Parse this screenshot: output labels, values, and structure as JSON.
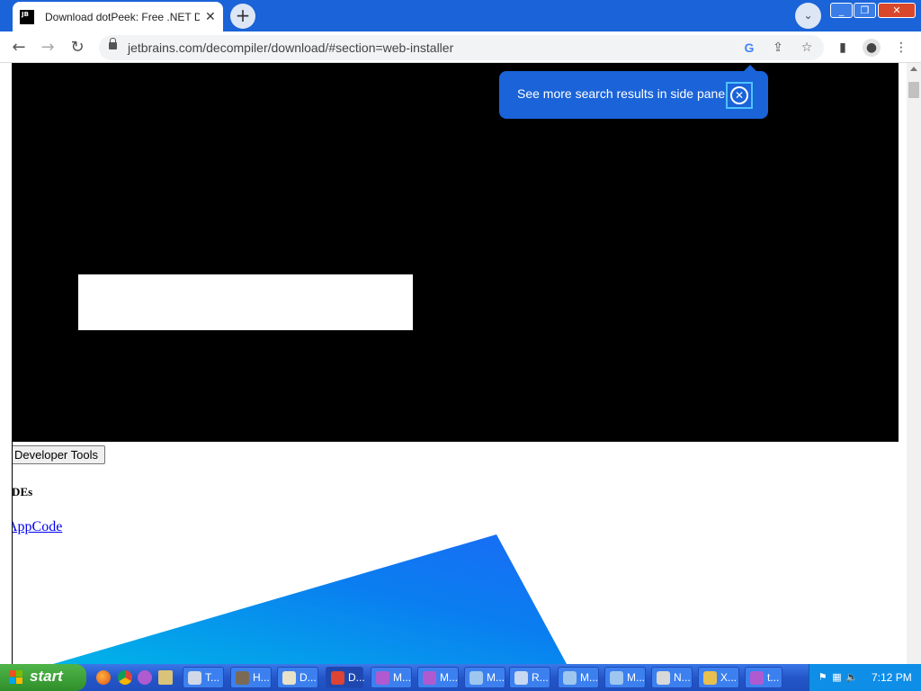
{
  "browser": {
    "tab": {
      "favicon_text": "JB",
      "title": "Download dotPeek: Free .NET Decompiler",
      "close_glyph": "✕"
    },
    "new_tab_glyph": "+",
    "tab_search_glyph": "⌄",
    "window_controls": {
      "minimize": "_",
      "maximize": "❐",
      "close": "✕"
    },
    "nav": {
      "back": "←",
      "forward": "→",
      "reload": "↻"
    },
    "url": "jetbrains.com/decompiler/download/#section=web-installer",
    "omnibox_icons": {
      "google": "G",
      "share": "⇪",
      "bookmark": "☆"
    },
    "toolbar_icons": {
      "side_panel": "▮",
      "profile": "●",
      "menu": "⋮"
    }
  },
  "page": {
    "dev_tools_button": "Developer Tools",
    "heading_ides": "IDEs",
    "link_appcode": "AppCode"
  },
  "bubble": {
    "text": "See more search results in side panel",
    "close_glyph": "✕"
  },
  "taskbar": {
    "start_label": "start",
    "tasks": [
      {
        "label": "T...",
        "icon_color": "#d0d8e8"
      },
      {
        "label": "H...",
        "icon_color": "#7a6a55"
      },
      {
        "label": "D...",
        "icon_color": "#e8e2c8"
      },
      {
        "label": "D...",
        "icon_color": "#dd4433"
      },
      {
        "label": "M...",
        "icon_color": "#b05ad0"
      },
      {
        "label": "M...",
        "icon_color": "#b05ad0"
      },
      {
        "label": "M...",
        "icon_color": "#9fc6ee"
      },
      {
        "label": "R...",
        "icon_color": "#c8d8f0"
      },
      {
        "label": "M...",
        "icon_color": "#9fc6ee"
      },
      {
        "label": "M...",
        "icon_color": "#9fc6ee"
      },
      {
        "label": "N...",
        "icon_color": "#d8d8d8"
      },
      {
        "label": "X...",
        "icon_color": "#e8c050"
      },
      {
        "label": "t...",
        "icon_color": "#b05ad0"
      }
    ],
    "clock": "7:12 PM"
  },
  "colors": {
    "chrome_blue": "#1a63d8",
    "start_green": "#3a9b35",
    "link_blue": "#0000ee"
  }
}
